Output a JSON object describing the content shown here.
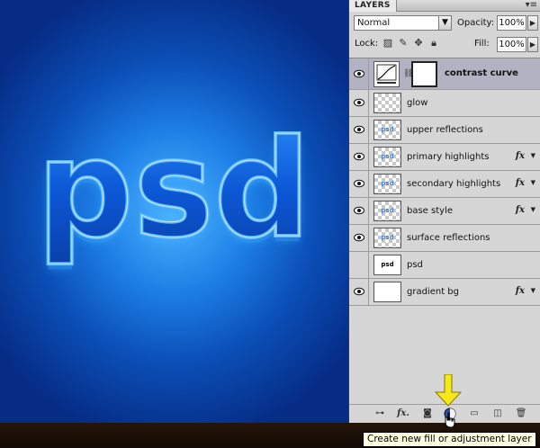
{
  "canvas": {
    "artwork_text": "psd",
    "colors": {
      "bg_center": "#4fb4ff",
      "bg_edge": "#062c86",
      "text_fill": "#0c58d6",
      "text_edge": "#59b6ff",
      "highlight": "#d8f2ff"
    }
  },
  "panel": {
    "tab_label": "LAYERS",
    "menu_icon": "panel-menu-icon",
    "blend_mode": "Normal",
    "opacity_label": "Opacity:",
    "opacity_value": "100%",
    "lock_label": "Lock:",
    "fill_label": "Fill:",
    "fill_value": "100%",
    "lock_icons": [
      "lock-transparent-icon",
      "lock-paint-icon",
      "lock-move-icon",
      "lock-all-icon"
    ]
  },
  "layers": [
    {
      "name": "contrast curve",
      "visible": true,
      "selected": true,
      "type": "adjustment",
      "fx": false
    },
    {
      "name": "glow",
      "visible": true,
      "selected": false,
      "type": "transparent",
      "fx": false
    },
    {
      "name": "upper reflections",
      "visible": true,
      "selected": false,
      "type": "text-thumb",
      "thumb_text": "psd",
      "fx": false
    },
    {
      "name": "primary highlights",
      "visible": true,
      "selected": false,
      "type": "text-thumb",
      "thumb_text": "psd",
      "fx": true
    },
    {
      "name": "secondary highlights",
      "visible": true,
      "selected": false,
      "type": "text-thumb",
      "thumb_text": "psd",
      "fx": true
    },
    {
      "name": "base style",
      "visible": true,
      "selected": false,
      "type": "text-thumb",
      "thumb_text": "psd",
      "fx": true
    },
    {
      "name": "surface reflections",
      "visible": true,
      "selected": false,
      "type": "text-thumb",
      "thumb_text": "psd",
      "fx": false
    },
    {
      "name": "psd",
      "visible": false,
      "selected": false,
      "type": "plain",
      "thumb_text": "psd",
      "fx": false
    },
    {
      "name": "gradient bg",
      "visible": true,
      "selected": false,
      "type": "white",
      "fx": true
    }
  ],
  "fx_label": "fx",
  "toolbar": {
    "buttons": [
      "link-layers-icon",
      "layer-style-icon",
      "add-mask-icon",
      "new-adjustment-layer-icon",
      "new-group-icon",
      "new-layer-icon",
      "delete-layer-icon"
    ],
    "fx_label": "fx."
  },
  "tooltip": "Create new fill or adjustment layer",
  "annotation_color": "#f4e81a"
}
